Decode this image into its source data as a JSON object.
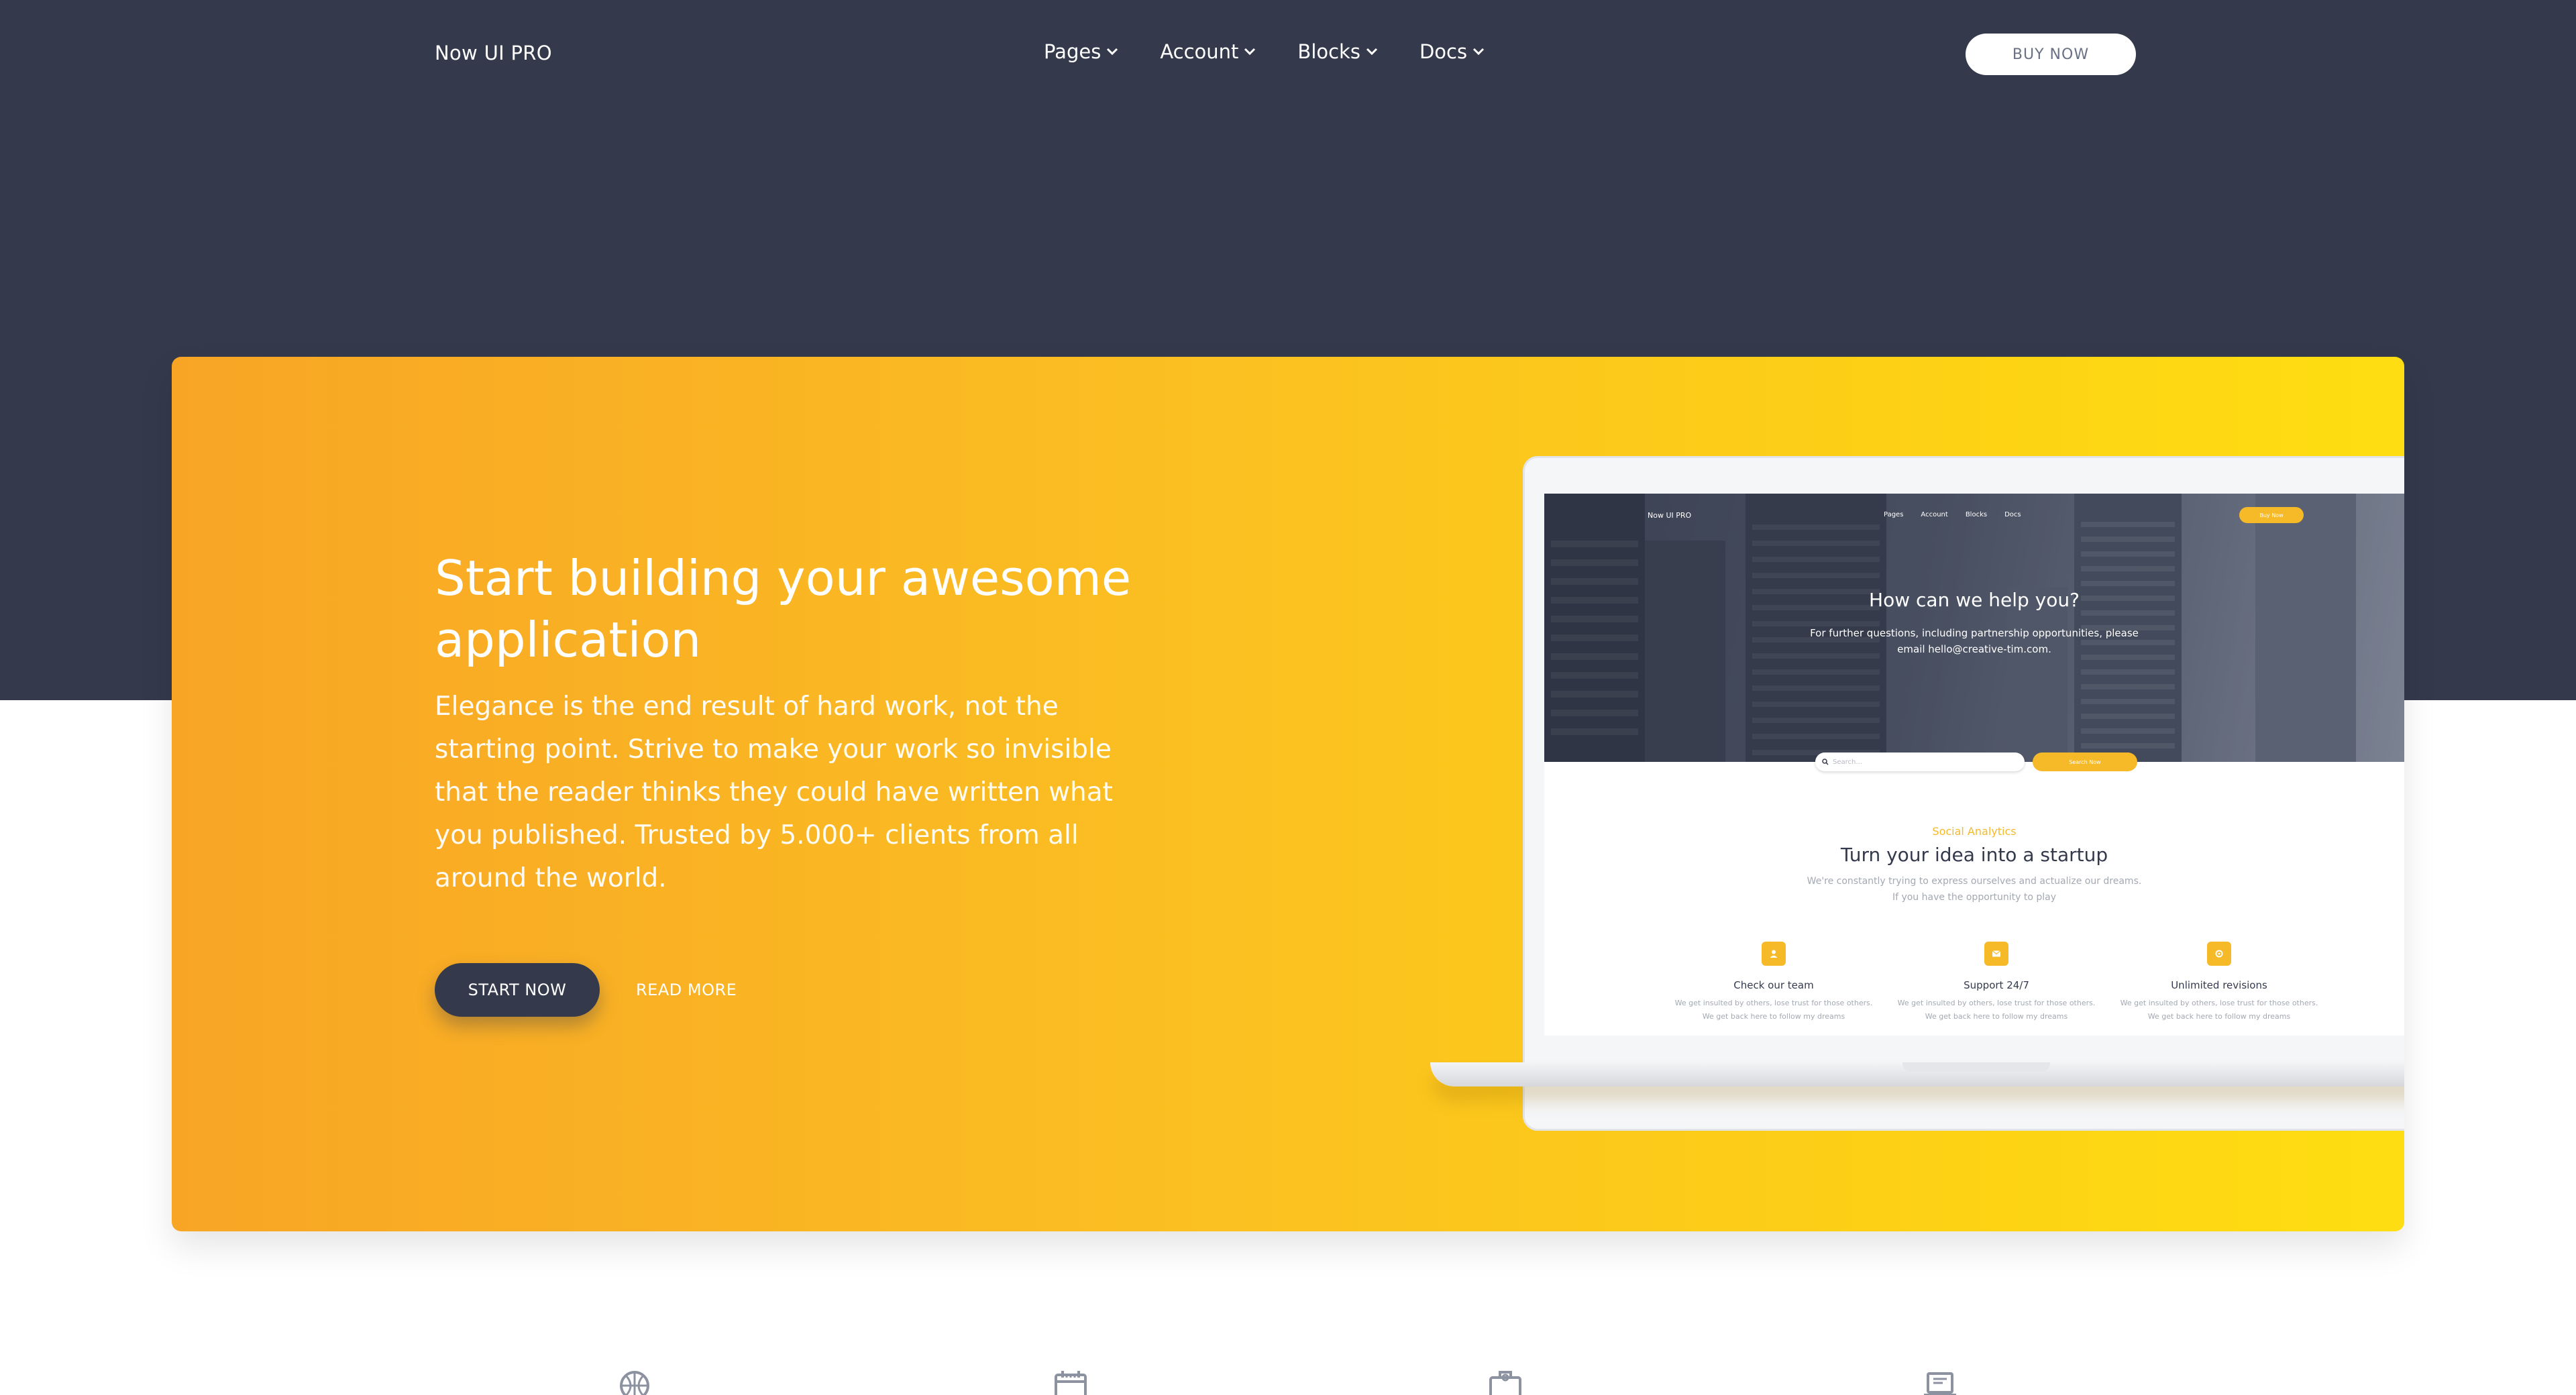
{
  "navbar": {
    "brand": "Now UI PRO",
    "menu": [
      {
        "label": "Pages"
      },
      {
        "label": "Account"
      },
      {
        "label": "Blocks"
      },
      {
        "label": "Docs"
      }
    ],
    "buy_button": "BUY NOW"
  },
  "hero": {
    "title": "Start building your awesome application",
    "description": "Elegance is the end result of hard work, not the starting point. Strive to make your work so invisible that the reader thinks they could have written what you published. Trusted by 5.000+ clients from all around the world.",
    "primary_button": "START NOW",
    "secondary_link": "READ MORE"
  },
  "mockup": {
    "brand": "Now UI PRO",
    "menu": [
      "Pages",
      "Account",
      "Blocks",
      "Docs"
    ],
    "buy_button": "Buy Now",
    "title": "How can we help you?",
    "subtitle": "For further questions, including partnership opportunities, please email hello@creative-tim.com.",
    "search_placeholder": "Search...",
    "search_button": "Search Now",
    "eyebrow": "Social Analytics",
    "heading": "Turn your idea into a startup",
    "lead": "We're constantly trying to express ourselves and actualize our dreams. If you have the opportunity to play",
    "features": [
      {
        "title": "Check our team",
        "text": "We get insulted by others, lose trust for those others. We get back here to follow my dreams",
        "icon": "user-icon"
      },
      {
        "title": "Support 24/7",
        "text": "We get insulted by others, lose trust for those others. We get back here to follow my dreams",
        "icon": "mail-icon"
      },
      {
        "title": "Unlimited revisions",
        "text": "We get insulted by others, lose trust for those others. We get back here to follow my dreams",
        "icon": "settings-icon"
      }
    ]
  },
  "bottom_icons": [
    "globe-icon",
    "calendar-icon",
    "briefcase-icon",
    "laptop-icon"
  ],
  "colors": {
    "dark": "#343a4c",
    "accent_orange": "#f8a525",
    "accent_yellow": "#fede12",
    "white": "#ffffff"
  }
}
